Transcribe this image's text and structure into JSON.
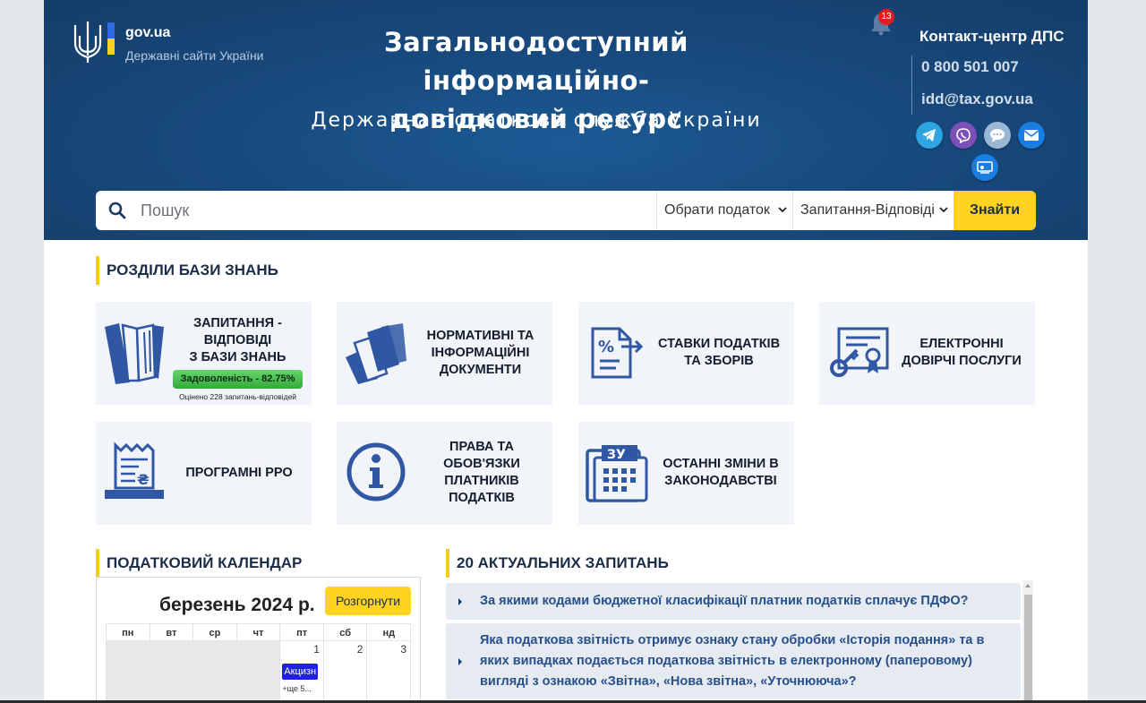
{
  "header": {
    "gov_label": "gov.ua",
    "gov_sub": "Державні сайти України",
    "title_line1": "Загальнодоступний інформаційно-",
    "title_line2": "довідковий ресурс",
    "subtitle": "Державна податкова служба України",
    "notifications_count": "13",
    "contact_title": "Контакт‑центр ДПС",
    "contact_phone": "0 800 501 007",
    "contact_email": "idd@tax.gov.ua",
    "social_icons": [
      "telegram-icon",
      "viber-icon",
      "chat-icon",
      "mail-icon",
      "online-consult-icon"
    ]
  },
  "search": {
    "placeholder": "Пошук",
    "tax_select": "Обрати податок",
    "type_select": "Запитання-Відповіді",
    "find_label": "Знайти"
  },
  "knowledge": {
    "title": "РОЗДІЛИ БАЗИ ЗНАНЬ",
    "tiles": [
      {
        "label1": "ЗАПИТАННЯ -",
        "label2": "ВІДПОВІДІ",
        "label3": "З БАЗИ ЗНАНЬ",
        "badge": "Задоволеність - 82.75%",
        "sub": "Оцінено 228 запитань‑відповідей"
      },
      {
        "label1": "НОРМАТИВНІ ТА",
        "label2": "ІНФОРМАЦІЙНІ",
        "label3": "ДОКУМЕНТИ"
      },
      {
        "label1": "СТАВКИ ПОДАТКІВ",
        "label2": "ТА ЗБОРІВ"
      },
      {
        "label1": "ЕЛЕКТРОННІ",
        "label2": "ДОВІРЧІ ПОСЛУГИ"
      },
      {
        "label1": "ПРОГРАМНІ РРО"
      },
      {
        "label1": "ПРАВА ТА",
        "label2": "ОБОВ'ЯЗКИ",
        "label3": "ПЛАТНИКІВ",
        "label4": "ПОДАТКІВ"
      },
      {
        "label1": "ОСТАННІ ЗМІНИ В",
        "label2": "ЗАКОНОДАВСТВІ",
        "icon_text": "ЗУ"
      }
    ]
  },
  "calendar": {
    "title": "ПОДАТКОВИЙ КАЛЕНДАР",
    "month": "березень 2024 р.",
    "expand_label": "Розгорнути",
    "weekdays": [
      "пн",
      "вт",
      "ср",
      "чт",
      "пт",
      "сб",
      "нд"
    ],
    "days": [
      "1",
      "2",
      "3"
    ],
    "event": "Акцизн",
    "more": "+ще 5..."
  },
  "faq": {
    "title": "20 АКТУАЛЬНИХ ЗАПИТАНЬ",
    "items": [
      {
        "line1": "За якими кодами бюджетної класифікації платник податків сплачує ПДФО?"
      },
      {
        "line1": "Яка податкова звітність отримує ознаку стану обробки «Історія подання» та в",
        "line2": "яких випадках подається податкова звітність в електронному (паперовому)",
        "line3": "вигляді з ознакою «Звітна», «Нова звітна», «Уточнююча»?"
      }
    ]
  },
  "colors": {
    "header_bg": "#184a7e",
    "accent_yellow": "#ffd320",
    "icon_blue": "#2f57a3",
    "tile_bg": "#f1f4f9",
    "faq_text": "#264f8c"
  }
}
